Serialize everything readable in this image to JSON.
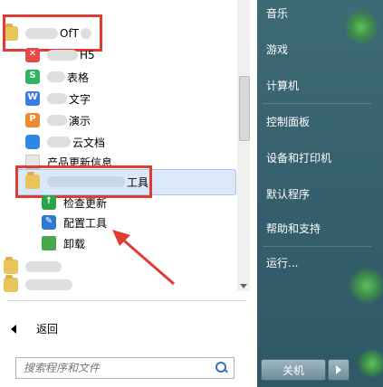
{
  "programs": {
    "office_folder": "OfT",
    "items": [
      {
        "label": "H5",
        "icon": "h5-icon",
        "icon_text": "✕"
      },
      {
        "label": "表格",
        "icon": "spreadsheet-icon",
        "icon_text": "S"
      },
      {
        "label": "文字",
        "icon": "writer-icon",
        "icon_text": "W"
      },
      {
        "label": "演示",
        "icon": "presentation-icon",
        "icon_text": "P"
      },
      {
        "label": "云文档",
        "icon": "cloud-doc-icon",
        "icon_text": ""
      },
      {
        "label": "产品更新信息",
        "icon": "info-icon",
        "icon_text": ""
      }
    ],
    "tools_folder": "工具",
    "tools_items": [
      {
        "label": "检查更新",
        "icon": "update-icon"
      },
      {
        "label": "配置工具",
        "icon": "config-tool-icon"
      },
      {
        "label": "卸载",
        "icon": "uninstall-icon"
      }
    ]
  },
  "nav": {
    "back_label": "返回",
    "search_placeholder": "搜索程序和文件"
  },
  "right_menu": [
    "音乐",
    "游戏",
    "计算机",
    "控制面板",
    "设备和打印机",
    "默认程序",
    "帮助和支持",
    "运行..."
  ],
  "power": {
    "shutdown_label": "关机"
  },
  "colors": {
    "annotation_red": "#e23b33",
    "highlight": "#dbe8f7"
  }
}
